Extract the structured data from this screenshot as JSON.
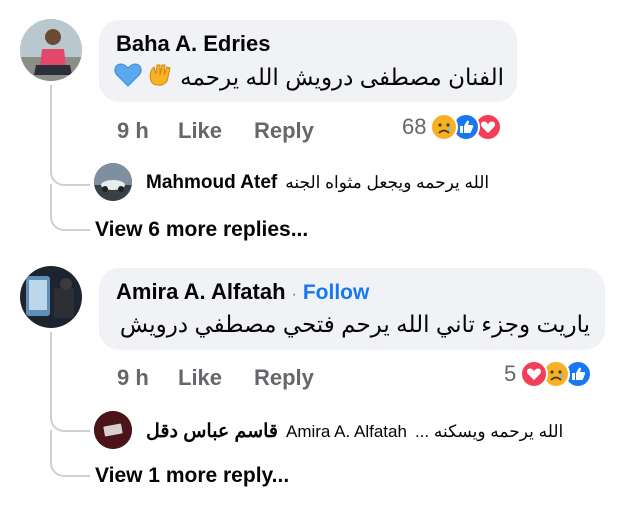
{
  "comments": [
    {
      "author": "Baha A. Edries",
      "text": "الفنان مصطفى درويش الله يرحمه",
      "emojis": [
        "👐",
        "💙"
      ],
      "time": "9 h",
      "like": "Like",
      "reply": "Reply",
      "reaction_count": "68",
      "reactions": [
        "sad",
        "like",
        "love"
      ],
      "reply_preview": {
        "author": "Mahmoud Atef",
        "text": "الله يرحمه ويجعل مثواه الجنه"
      },
      "view_more": "View 6 more replies..."
    },
    {
      "author": "Amira A. Alfatah",
      "separator": "·",
      "follow": "Follow",
      "text": "ياريت وجزء تاني الله يرحم فتحي مصطفي درويش",
      "time": "9 h",
      "like": "Like",
      "reply": "Reply",
      "reaction_count": "5",
      "reactions": [
        "love",
        "sad",
        "like"
      ],
      "reply_preview": {
        "author": "قاسم عباس دقل",
        "mention": "Amira A. Alfatah",
        "text": "الله يرحمه ويسكنه ..."
      },
      "view_more": "View 1 more reply..."
    }
  ],
  "colors": {
    "bubble": "#f0f2f5",
    "like_blue": "#1877f2",
    "love_red": "#f33e58",
    "sad_yellow": "#f7b125",
    "meta_gray": "#65676b"
  }
}
